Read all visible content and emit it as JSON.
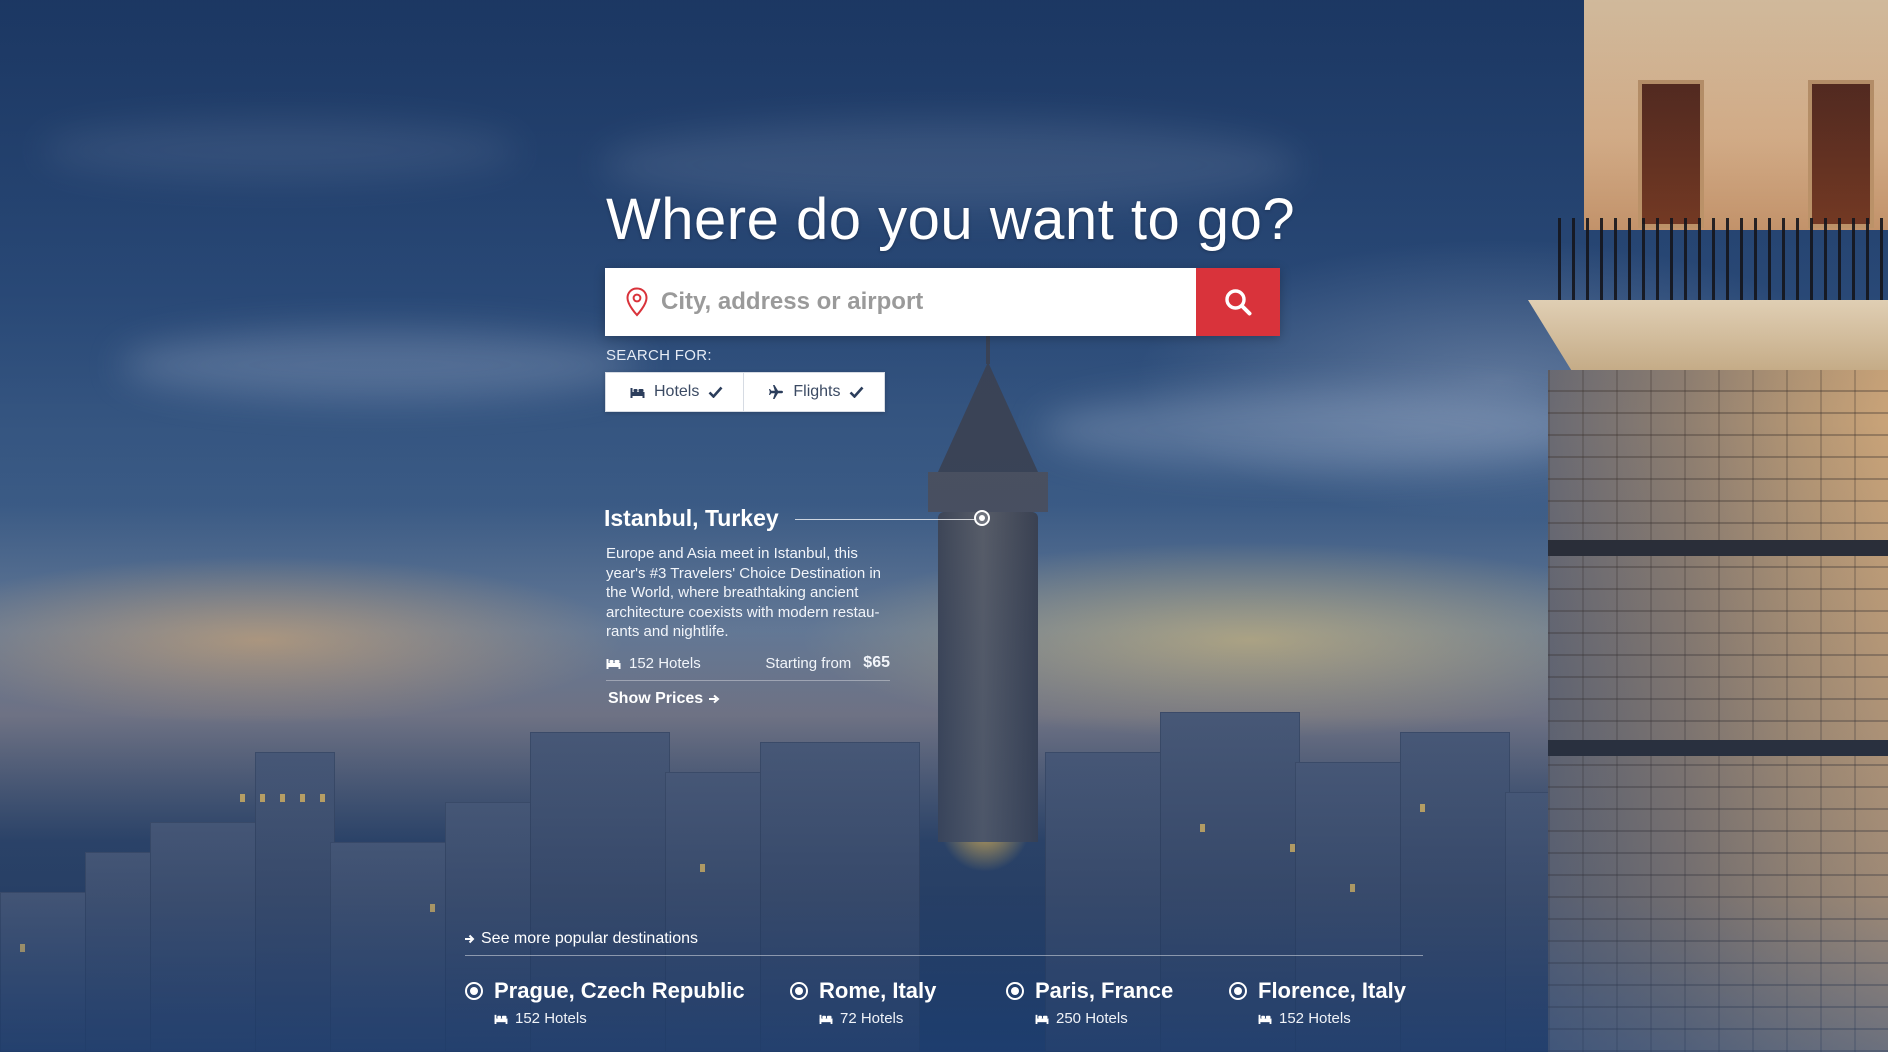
{
  "hero": {
    "title": "Where do you want to go?"
  },
  "search": {
    "placeholder": "City, address or airport",
    "value": ""
  },
  "search_for": {
    "label": "SEARCH FOR:",
    "options": [
      {
        "label": "Hotels",
        "icon": "bed-icon",
        "checked": true
      },
      {
        "label": "Flights",
        "icon": "plane-icon",
        "checked": true
      }
    ]
  },
  "featured": {
    "name": "Istanbul, Turkey",
    "description": "Europe and Asia meet in Istanbul, this year's #3 Travelers' Choice Destination in the World, where breathtaking ancient architecture coexists with modern restau-rants and nightlife.",
    "hotels": "152 Hotels",
    "starting_label": "Starting from",
    "price": "$65",
    "cta": "Show Prices"
  },
  "popular": {
    "link": "See more popular destinations",
    "destinations": [
      {
        "name": "Prague, Czech Republic",
        "hotels": "152 Hotels"
      },
      {
        "name": "Rome, Italy",
        "hotels": "72 Hotels"
      },
      {
        "name": "Paris, France",
        "hotels": "250 Hotels"
      },
      {
        "name": "Florence, Italy",
        "hotels": "152 Hotels"
      }
    ]
  },
  "colors": {
    "accent": "#d9333b",
    "text_on_image": "#ffffff",
    "toggle_text": "#3b4a63"
  }
}
